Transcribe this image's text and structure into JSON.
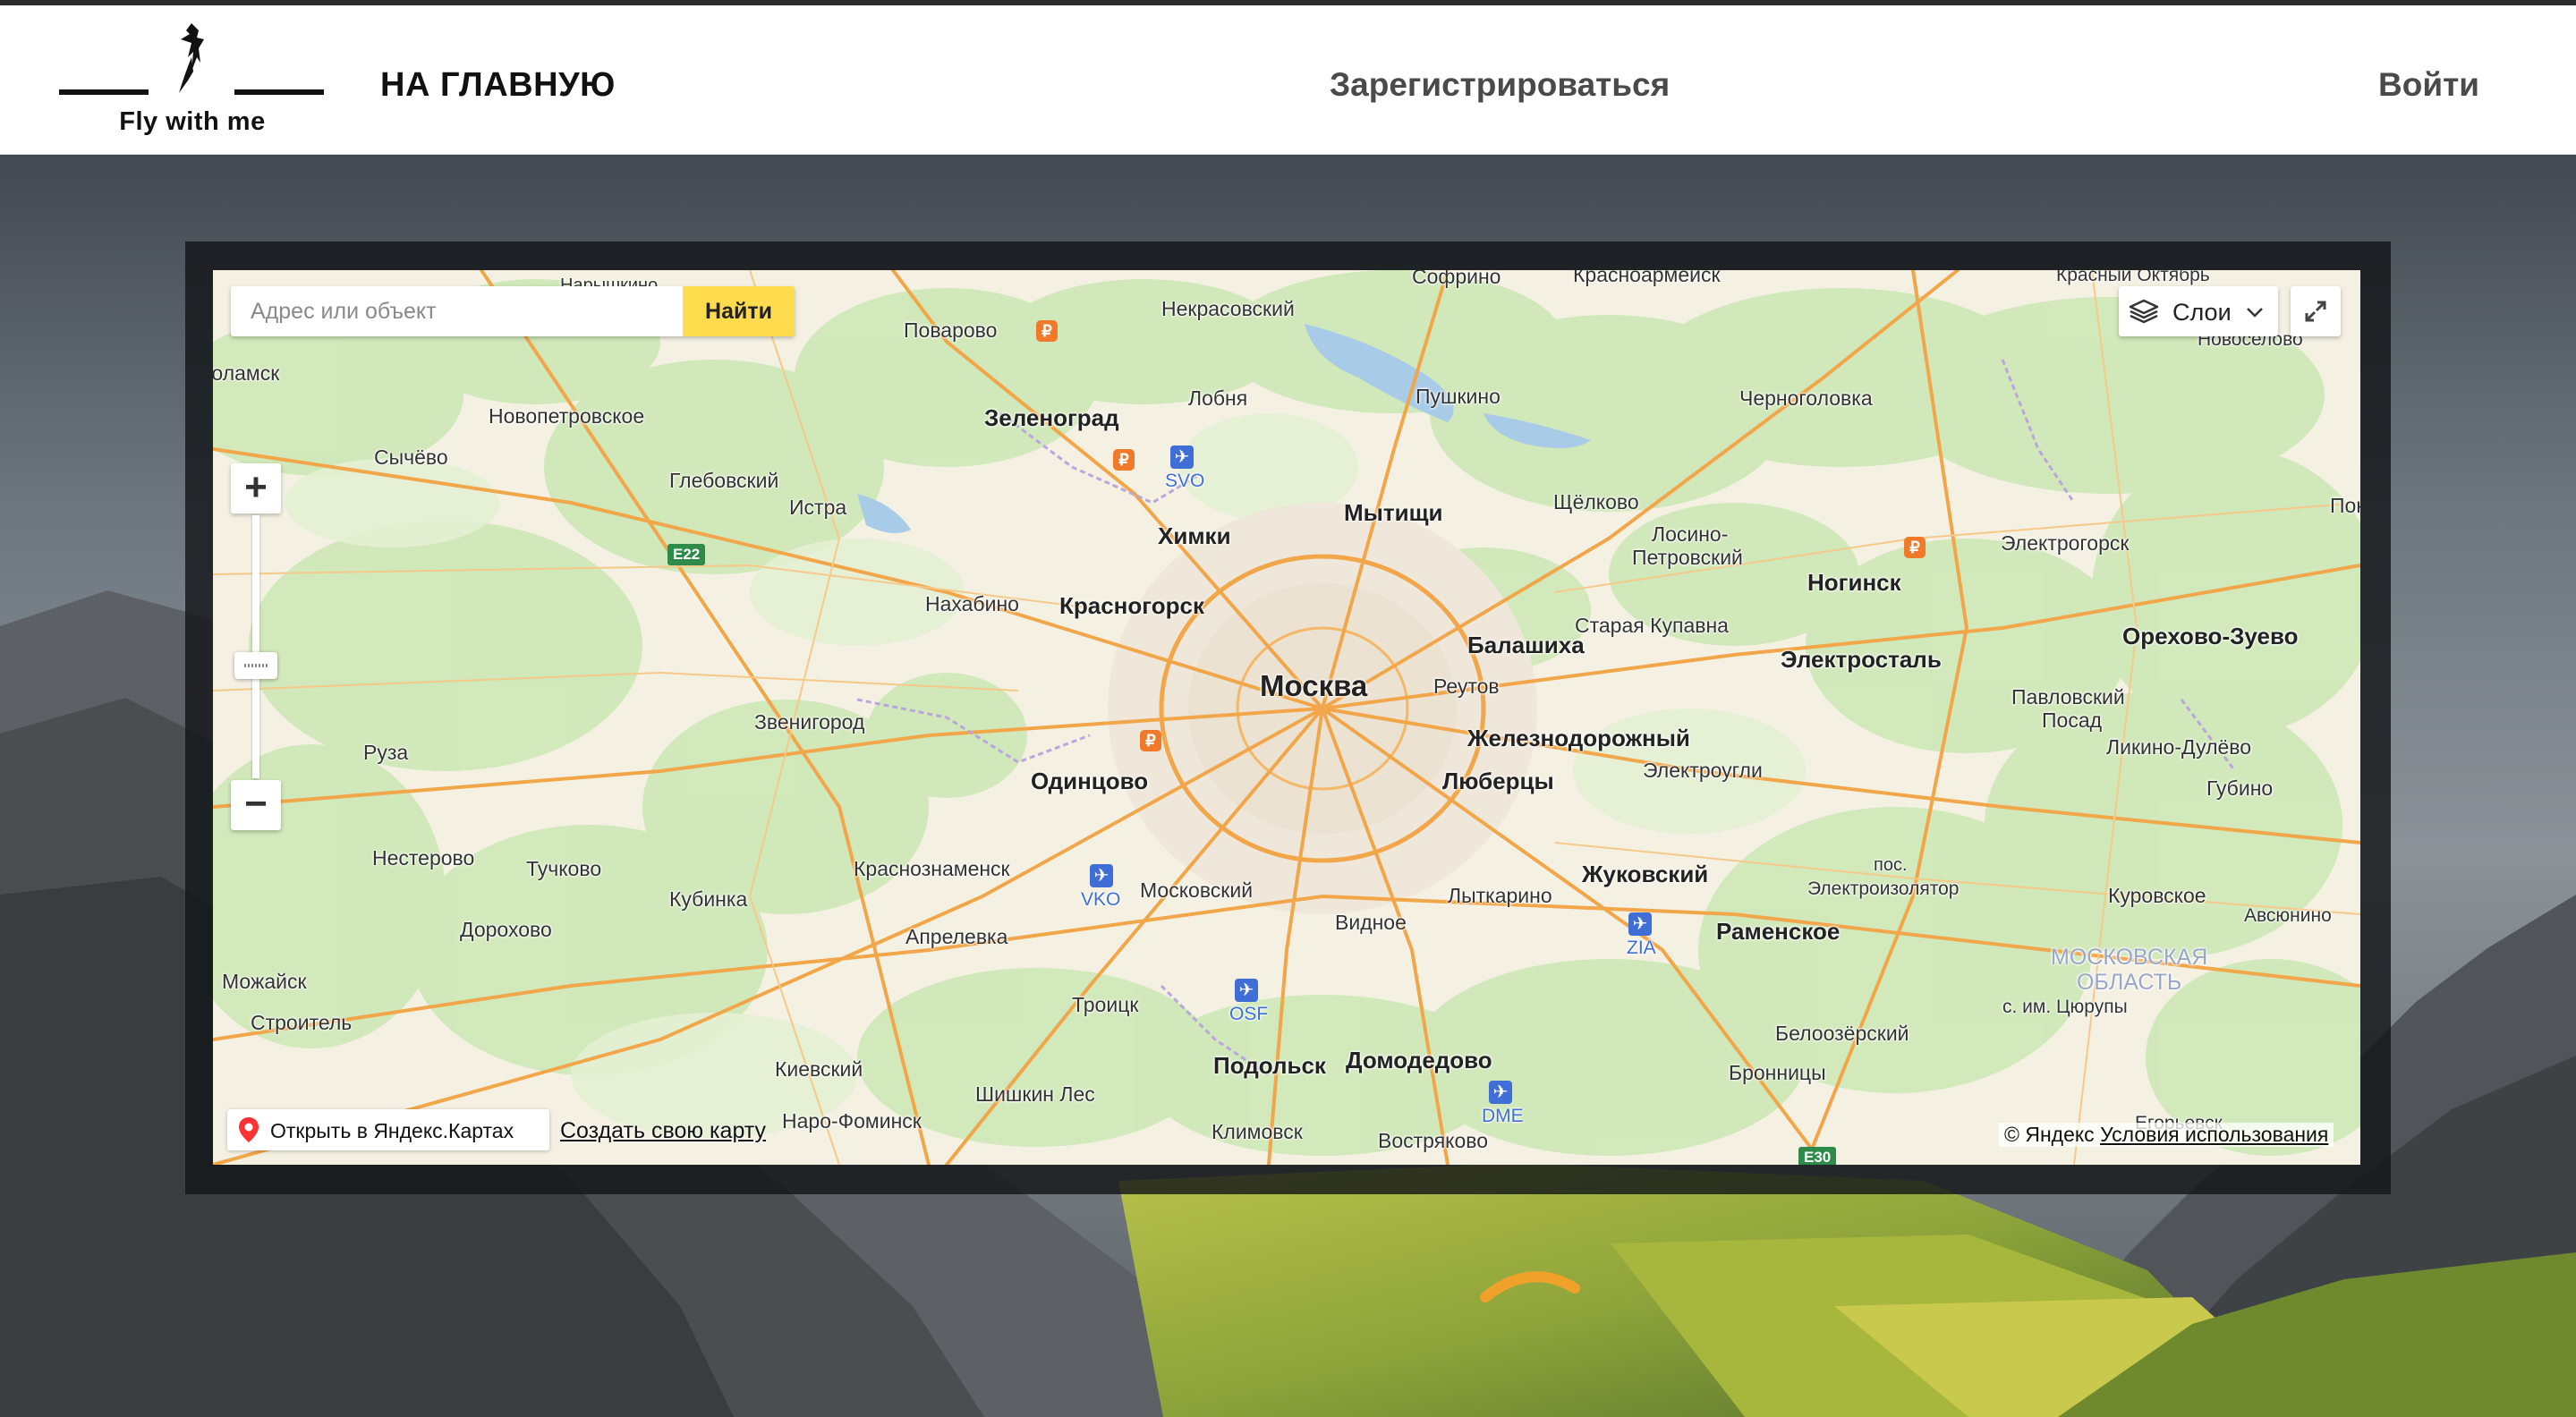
{
  "header": {
    "logo_text": "Fly with me",
    "nav_home": "НА ГЛАВНУЮ",
    "nav_register": "Зарегистрироваться",
    "nav_login": "Войти"
  },
  "map": {
    "search": {
      "placeholder": "Адрес или объект",
      "button_label": "Найти"
    },
    "layers_label": "Слои",
    "zoom_in_label": "+",
    "zoom_out_label": "−",
    "open_in_yandex": "Открыть в Яндекс.Картах",
    "create_map": "Создать свою карту",
    "copyright": "© Яндекс",
    "terms": "Условия использования",
    "road_badges": [
      "E22",
      "E30"
    ],
    "airports": [
      "SVO",
      "VKO",
      "OSF",
      "ZIA",
      "DME"
    ],
    "capital": "Москва",
    "region_label": "МОСКОВСКАЯ ОБЛАСТЬ",
    "region_label_lines": [
      "МОСКОВСКАЯ",
      "ОБЛАСТЬ"
    ],
    "cities": [
      "Зеленоград",
      "Химки",
      "Мытищи",
      "Красногорск",
      "Балашиха",
      "Реутов",
      "Одинцово",
      "Люберцы",
      "Железнодорожный",
      "Жуковский",
      "Раменское",
      "Подольск",
      "Домодедово",
      "Ногинск",
      "Электросталь",
      "Орехово-Зуево"
    ],
    "towns": [
      "Нарышкино",
      "Софрино",
      "Красноармейск",
      "Красный Октябрь",
      "Новоселово",
      "Поварово",
      "Некрасовский",
      "Лобня",
      "Пушкино",
      "Черноголовка",
      "Сычёво",
      "Новопетровское",
      "Глебовский",
      "Истра",
      "Щёлково",
      "Лосино-",
      "Петровский",
      "Электрогорск",
      "Покров",
      "Нахабино",
      "Старая Купавна",
      "Звенигород",
      "Руза",
      "Павловский",
      "Посад",
      "Ликино-Дулёво",
      "Электроугли",
      "Губино",
      "Нестерово",
      "Тучково",
      "Кубинка",
      "Краснознаменск",
      "Московский",
      "Лыткарино",
      "пос.",
      "Электроизолятор",
      "Куровское",
      "Авсюнино",
      "Дорохово",
      "Апрелевка",
      "Видное",
      "Можайск",
      "Троицк",
      "с. им. Цюрупы",
      "Строитель",
      "Белоозёрский",
      "Киевский",
      "Шишкин Лес",
      "Бронницы",
      "Наро-Фоминск",
      "Климовск",
      "Востряково",
      "Егорьевск",
      "Волоколамск"
    ]
  },
  "colors": {
    "accent_yellow": "#ffdb4d",
    "airport_blue": "#3f6fd6",
    "header_bg": "#ffffff",
    "frame_dark": "#141618"
  },
  "icons": [
    "bird-logo-icon",
    "layers-icon",
    "chevron-down-icon",
    "fullscreen-icon",
    "map-pin-icon",
    "plane-icon",
    "ruble-icon"
  ]
}
